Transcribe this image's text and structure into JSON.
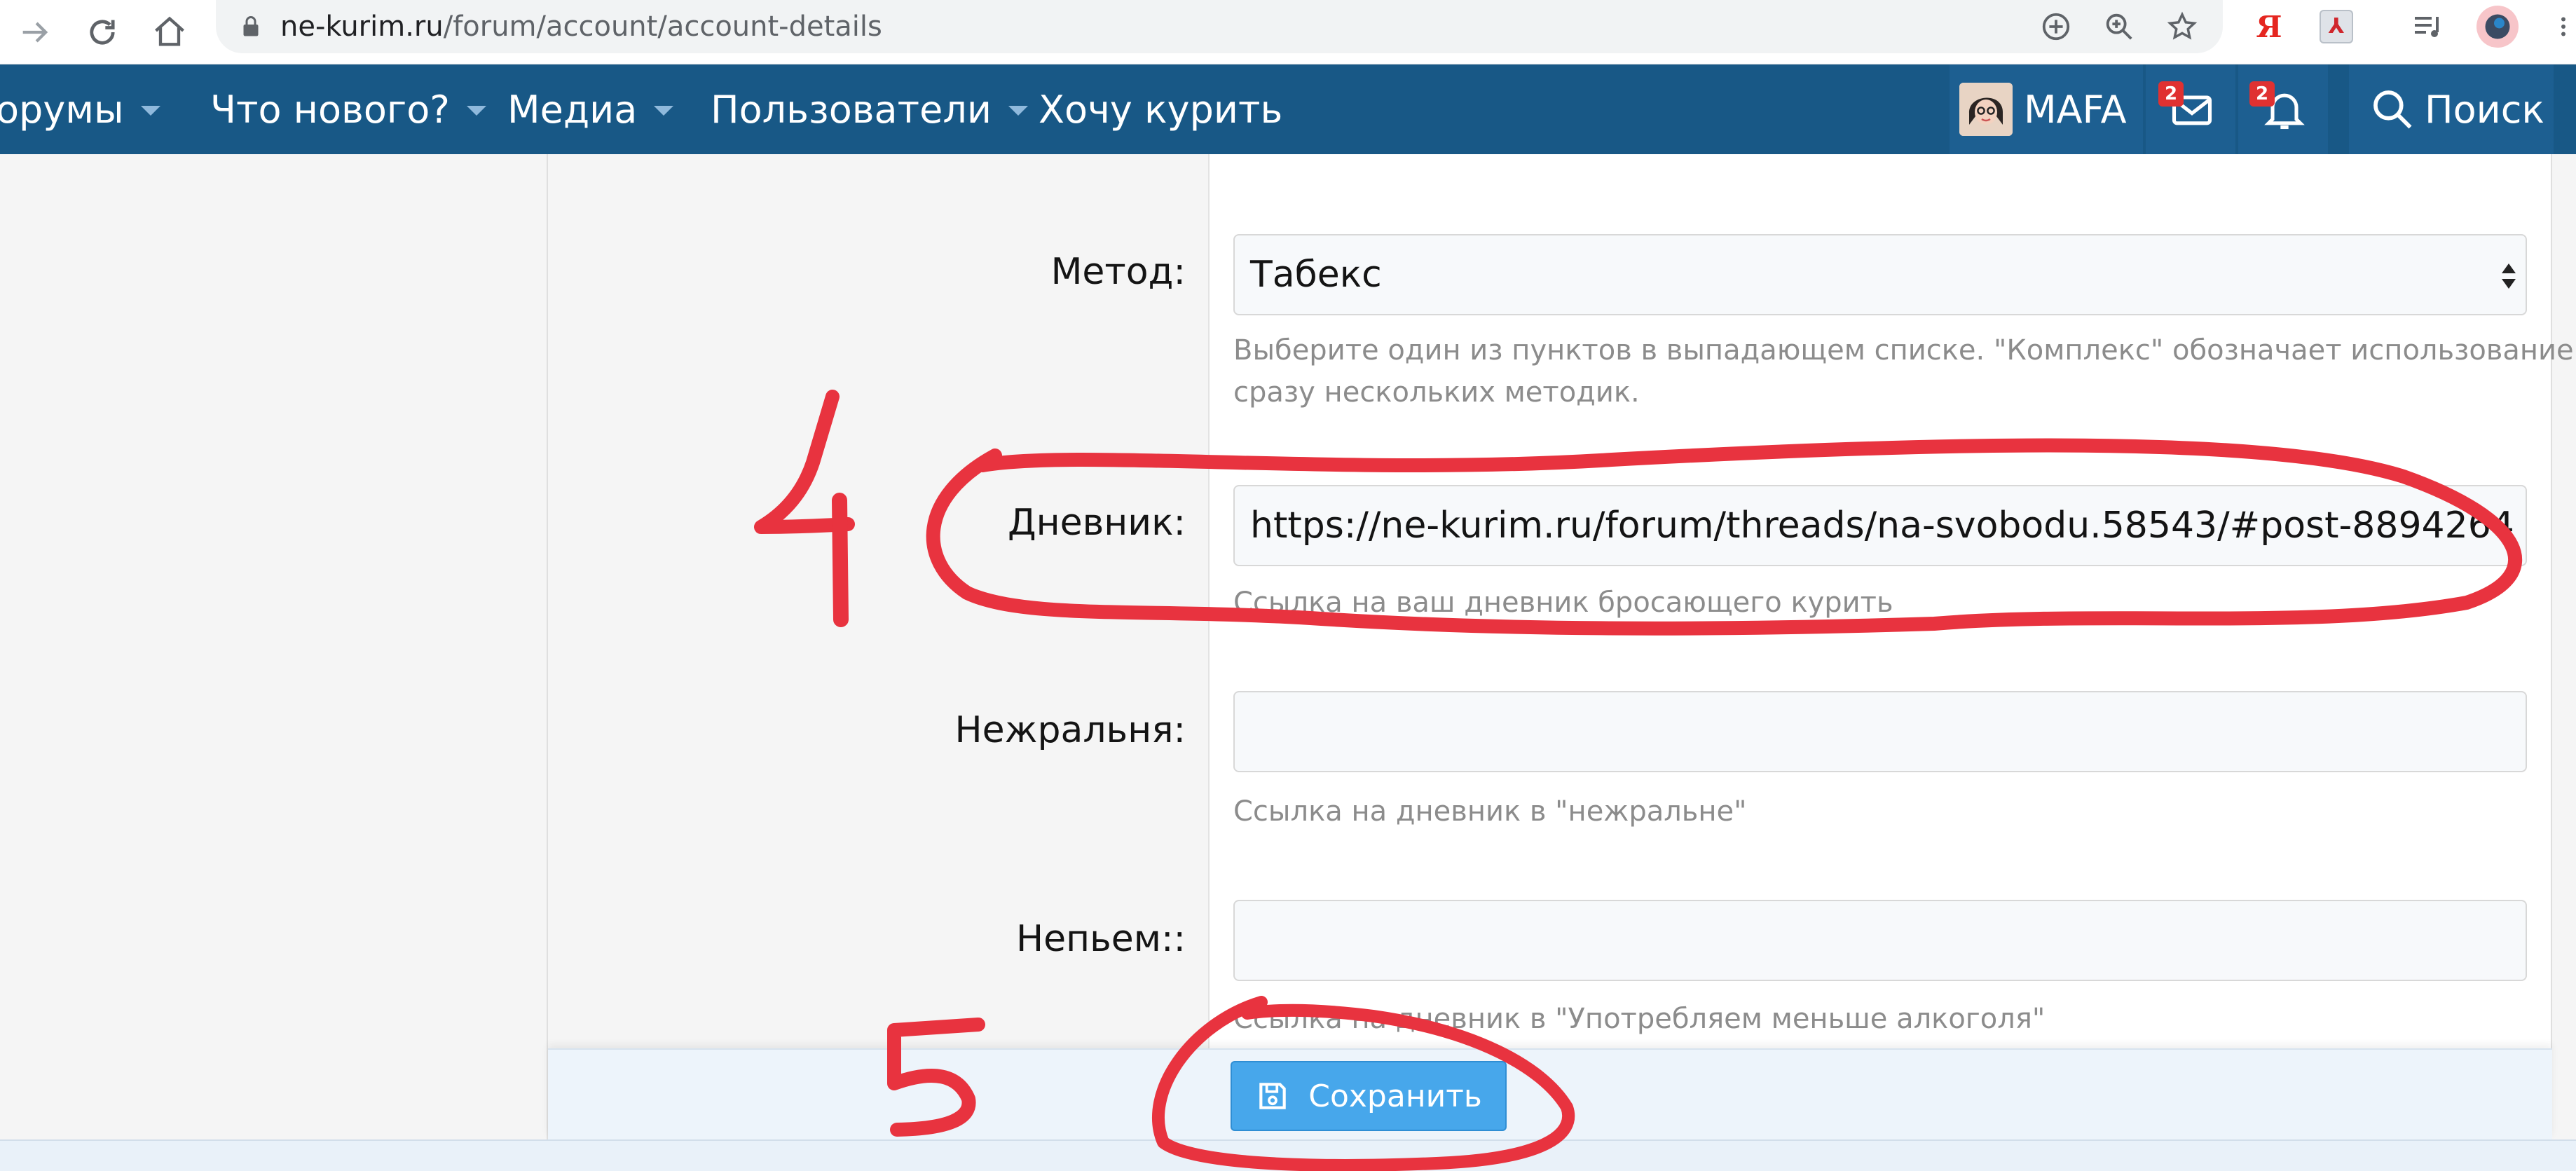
{
  "browser": {
    "url_host": "ne-kurim.ru",
    "url_path": "/forum/account/account-details",
    "extension_ya_label": "Я",
    "icons": [
      "forward-icon",
      "reload-icon",
      "home-icon",
      "lock-icon",
      "add-icon",
      "zoom-icon",
      "star-icon",
      "yandex-icon",
      "pdf-icon",
      "media-icon",
      "profile-icon",
      "menu-icon"
    ]
  },
  "sitenav": {
    "items": [
      {
        "label": "орумы"
      },
      {
        "label": "Что нового?"
      },
      {
        "label": "Медиа"
      },
      {
        "label": "Пользователи"
      },
      {
        "label": "Хочу курить"
      }
    ],
    "username": "MAFA",
    "messages_count": "2",
    "alerts_count": "2",
    "search_label": "Поиск"
  },
  "form": {
    "method": {
      "label": "Метод:",
      "value": "Табекс",
      "hint_line1": "Выберите один из пунктов в выпадающем списке. \"Комплекс\" обозначает использование",
      "hint_line2": "сразу нескольких методик."
    },
    "diary": {
      "label": "Дневник:",
      "value": "https://ne-kurim.ru/forum/threads/na-svobodu.58543/#post-8894264",
      "hint": "Ссылка на ваш дневник бросающего курить"
    },
    "nezhralnya": {
      "label": "Нежральня:",
      "value": "",
      "hint": "Ссылка на дневник в \"нежральне\""
    },
    "nepyem": {
      "label": "Непьем::",
      "value": "",
      "hint": "Ссылка на дневник в \"Употребляем меньше алкоголя\""
    },
    "save_label": "Сохранить"
  },
  "colors": {
    "nav_bg": "#185886",
    "button": "#47a7eb",
    "annotation": "#e8333f"
  }
}
